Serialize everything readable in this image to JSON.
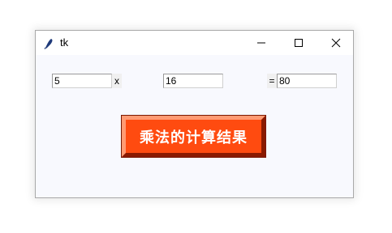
{
  "window": {
    "title": "tk"
  },
  "form": {
    "operand1_value": "5",
    "operator_label": "x",
    "operand2_value": "16",
    "equals_label": "=",
    "result_value": "80"
  },
  "actions": {
    "calculate_label": "乘法的计算结果"
  },
  "colors": {
    "button_bg": "#ff4b10",
    "window_bg": "#f8f9fe"
  }
}
